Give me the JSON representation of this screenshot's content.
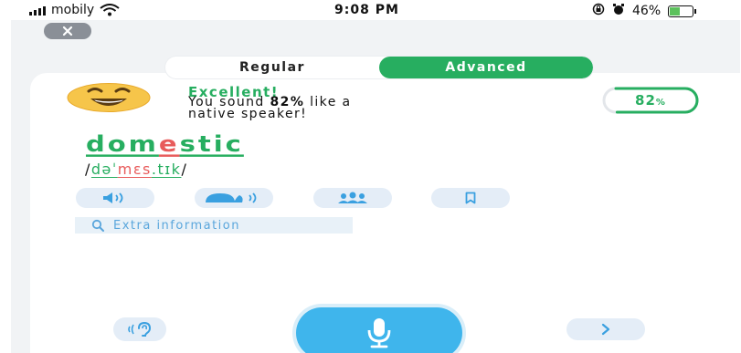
{
  "status_bar": {
    "carrier": "mobily",
    "time": "9:08 PM",
    "battery_percent": "46%",
    "battery_level": 0.46,
    "icons": [
      "signal-icon",
      "wifi-icon",
      "screen-lock-icon",
      "alarm-icon",
      "battery-icon"
    ]
  },
  "toggle": {
    "regular_label": "Regular",
    "advanced_label": "Advanced",
    "selected": "Advanced"
  },
  "feedback": {
    "title": "Excellent!",
    "line1_prefix": "You sound ",
    "line1_bold": "82%",
    "line1_suffix": " like a",
    "line2": "native speaker!",
    "score_value": "82",
    "score_unit": "%",
    "score_fraction": 0.82
  },
  "word": {
    "parts": [
      "dom",
      "e",
      "stic"
    ],
    "part_status": [
      "good",
      "bad",
      "good"
    ]
  },
  "ipa": {
    "open": "/",
    "parts": [
      "dəˈ",
      "mɛs",
      ".tɪk"
    ],
    "part_status": [
      "good",
      "bad",
      "good"
    ],
    "close": "/"
  },
  "extra": {
    "label": "Extra information"
  },
  "colors": {
    "green": "#27ae60",
    "red": "#e85b5b",
    "blue": "#3fb5ec",
    "pill_bg": "#e4edf7",
    "icon_blue": "#3aa0e0"
  },
  "icons": {
    "close": "close-icon",
    "emoji": "smiling-face-emoji-icon",
    "listen": "speaker-icon",
    "slow": "snail-icon",
    "community": "people-icon",
    "bookmark": "bookmark-icon",
    "search": "search-icon",
    "ear": "ear-icon",
    "mic": "microphone-icon",
    "next": "chevron-right-icon"
  }
}
